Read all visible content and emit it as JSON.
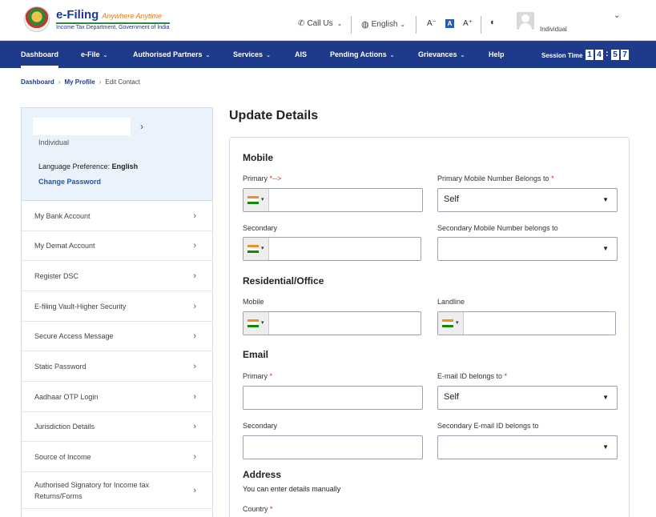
{
  "header": {
    "logo_title": "e-Filing",
    "logo_tagline": "Anywhere Anytime",
    "logo_subtitle": "Income Tax Department, Government of India",
    "call_us": "Call Us",
    "language": "English",
    "font_decrease": "A⁻",
    "font_normal": "A",
    "font_increase": "A⁺",
    "contrast_icon": "◐",
    "user_role": "Individual"
  },
  "nav": {
    "items": [
      {
        "label": "Dashboard",
        "caret": false
      },
      {
        "label": "e-File",
        "caret": true
      },
      {
        "label": "Authorised Partners",
        "caret": true
      },
      {
        "label": "Services",
        "caret": true
      },
      {
        "label": "AIS",
        "caret": false
      },
      {
        "label": "Pending Actions",
        "caret": true
      },
      {
        "label": "Grievances",
        "caret": true
      },
      {
        "label": "Help",
        "caret": false
      }
    ],
    "session_label": "Session Time",
    "session_digits": [
      "1",
      "4",
      "5",
      "7"
    ],
    "session_colon": ":"
  },
  "breadcrumb": {
    "items": [
      "Dashboard",
      "My Profile",
      "Edit Contact"
    ]
  },
  "sidebar": {
    "role": "Individual",
    "language_pref_label": "Language Preference:",
    "language_pref_value": "English",
    "change_password": "Change Password",
    "items": [
      "My Bank Account",
      "My Demat Account",
      "Register DSC",
      "E-filing Vault-Higher Security",
      "Secure Access Message",
      "Static Password",
      "Aadhaar OTP Login",
      "Jurisdiction Details",
      "Source of Income",
      "Authorised Signatory for Income tax Returns/Forms"
    ]
  },
  "form": {
    "title": "Update Details",
    "mobile_section": "Mobile",
    "primary_label": "Primary",
    "primary_marker": "*-->",
    "primary_belongs_label": "Primary Mobile Number Belongs to",
    "primary_belongs_value": "Self",
    "secondary_label": "Secondary",
    "secondary_belongs_label": "Secondary Mobile Number belongs to",
    "secondary_belongs_value": "",
    "residential_section": "Residential/Office",
    "res_mobile_label": "Mobile",
    "res_landline_label": "Landline",
    "email_section": "Email",
    "email_primary_label": "Primary",
    "email_belongs_label": "E-mail ID belongs to",
    "email_belongs_value": "Self",
    "email_secondary_label": "Secondary",
    "email_secondary_belongs_label": "Secondary E-mail ID belongs to",
    "email_secondary_belongs_value": "",
    "address_section": "Address",
    "address_hint": "You can enter details manually",
    "country_label": "Country",
    "required_mark": "*"
  }
}
